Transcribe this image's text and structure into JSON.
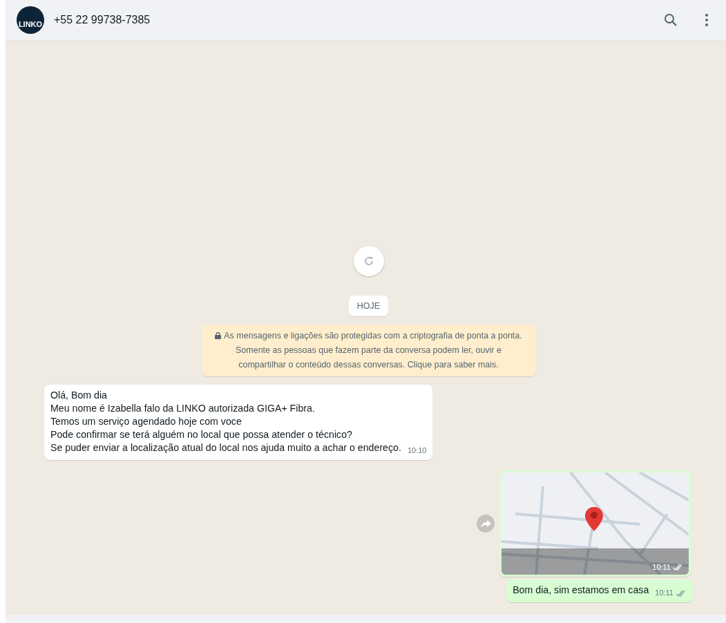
{
  "header": {
    "avatar_text": "LINKO",
    "title": "+55 22 99738-7385"
  },
  "date_chip": "HOJE",
  "encryption_notice": "As mensagens e ligações são protegidas com a criptografia de ponta a ponta. Somente as pessoas que fazem parte da conversa podem ler, ouvir e compartilhar o conteúdo dessas conversas. Clique para saber mais.",
  "messages": [
    {
      "kind": "text",
      "outgoing": false,
      "lines": [
        "Olá, Bom dia",
        "Meu nome é Izabella falo da LINKO autorizada GIGA+ Fibra.",
        "Temos um serviço agendado hoje com voce",
        "Pode confirmar se terá alguém no local que possa atender o técnico?",
        "Se puder enviar a localização atual do local nos ajuda muito a achar o endereço."
      ],
      "time": "10:10"
    },
    {
      "kind": "location",
      "outgoing": true,
      "time": "10:11",
      "double_check": true
    },
    {
      "kind": "text",
      "outgoing": true,
      "lines": [
        "Bom dia, sim estamos em casa"
      ],
      "time": "10:11",
      "double_check": true
    }
  ]
}
